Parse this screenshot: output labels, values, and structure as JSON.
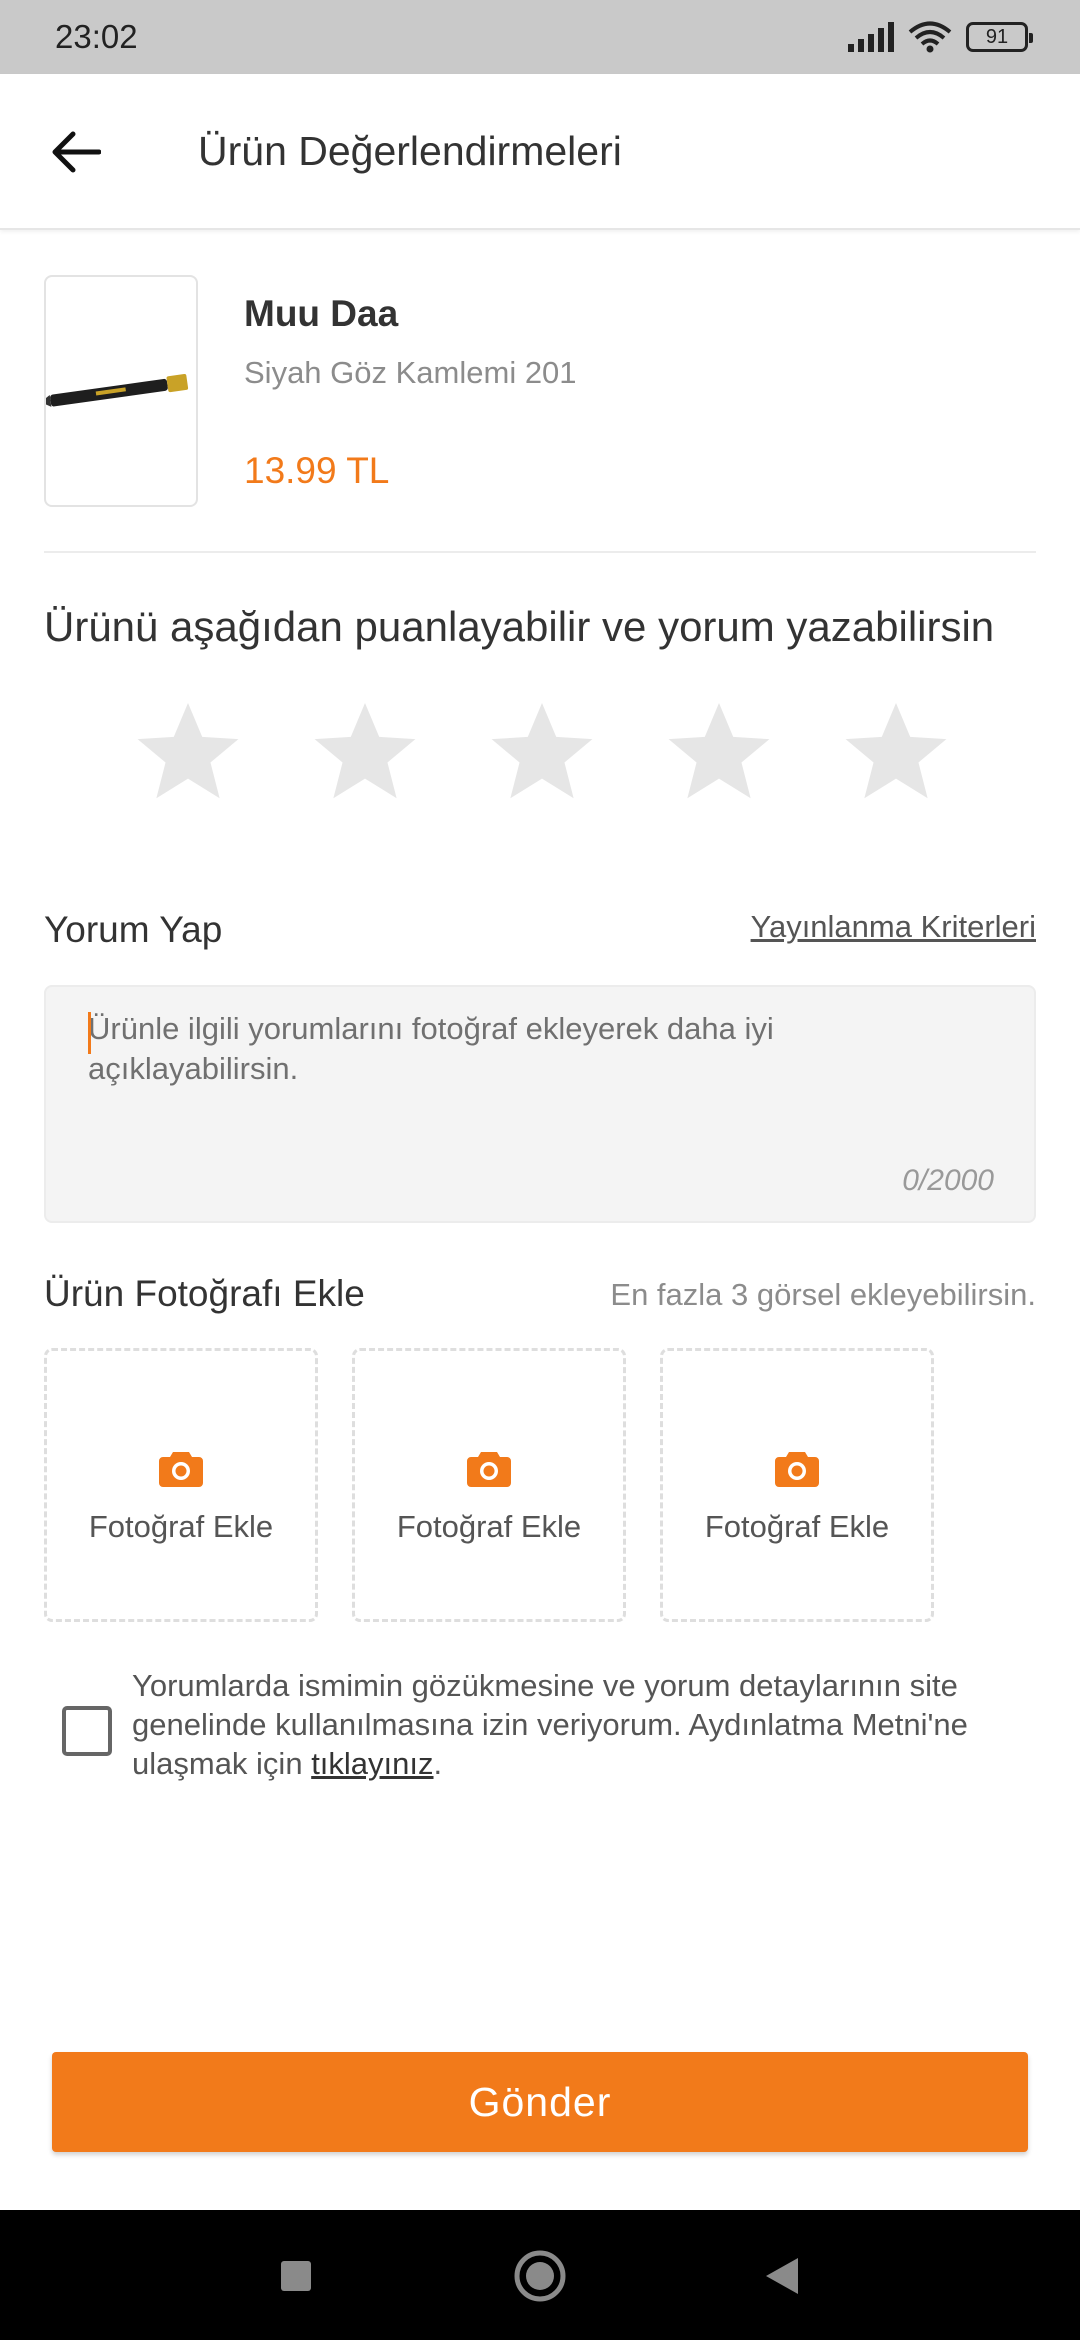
{
  "status_bar": {
    "time": "23:02",
    "battery": "91"
  },
  "app_bar": {
    "title": "Ürün Değerlendirmeleri"
  },
  "product": {
    "brand": "Muu Daa",
    "name": "Siyah Göz Kamlemi 201",
    "price": "13.99 TL"
  },
  "rating": {
    "prompt": "Ürünü aşağıdan puanlayabilir ve yorum yazabilirsin",
    "max_stars": 5,
    "selected": 0
  },
  "comment": {
    "label": "Yorum Yap",
    "criteria_link": "Yayınlanma Kriterleri",
    "placeholder": "Ürünle ilgili yorumlarını fotoğraf ekleyerek daha iyi açıklayabilirsin.",
    "value": "",
    "counter": "0/2000"
  },
  "photos": {
    "label": "Ürün Fotoğrafı Ekle",
    "hint": "En fazla 3 görsel ekleyebilirsin.",
    "slots": [
      {
        "label": "Fotoğraf Ekle"
      },
      {
        "label": "Fotoğraf Ekle"
      },
      {
        "label": "Fotoğraf Ekle"
      }
    ]
  },
  "consent": {
    "text_before": "Yorumlarda ismimin gözükmesine ve yorum detaylarının site genelinde kullanılmasına izin veriyorum. Aydınlatma Metni'ne ulaşmak için ",
    "link_text": "tıklayınız",
    "text_after": ".",
    "checked": false
  },
  "submit": {
    "label": "Gönder"
  },
  "colors": {
    "accent": "#f27a1a",
    "star_empty": "#e6e6e6",
    "status_bar": "#c9c9c9"
  },
  "icons": {
    "back": "arrow-left-icon",
    "star": "star-icon",
    "camera": "camera-icon",
    "nav_recents": "square-icon",
    "nav_home": "circle-icon",
    "nav_back": "triangle-back-icon"
  }
}
